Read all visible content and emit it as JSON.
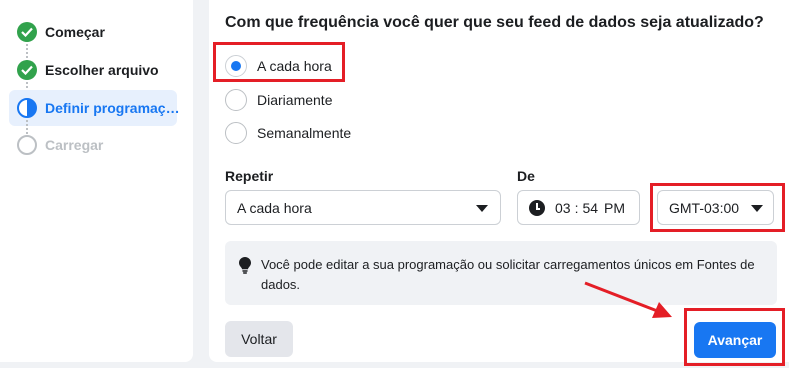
{
  "steps": [
    {
      "label": "Começar",
      "state": "done"
    },
    {
      "label": "Escolher arquivo",
      "state": "done"
    },
    {
      "label": "Definir programaç…",
      "state": "active"
    },
    {
      "label": "Carregar",
      "state": "pending"
    }
  ],
  "question": "Com que frequência você quer que seu feed de dados seja atualizado?",
  "frequency_options": [
    {
      "label": "A cada hora",
      "selected": true
    },
    {
      "label": "Diariamente",
      "selected": false
    },
    {
      "label": "Semanalmente",
      "selected": false
    }
  ],
  "repeat": {
    "label": "Repetir",
    "value": "A cada hora"
  },
  "from": {
    "label": "De",
    "hour": "03",
    "minute": "54",
    "ampm": "PM"
  },
  "timezone": {
    "value": "GMT-03:00"
  },
  "info": {
    "text": "Você pode editar a sua programação ou solicitar carregamentos únicos em Fontes de dados."
  },
  "buttons": {
    "back": "Voltar",
    "next": "Avançar"
  },
  "colors": {
    "accent": "#1877f2",
    "success": "#31a24c",
    "annotation": "#e41e26"
  }
}
